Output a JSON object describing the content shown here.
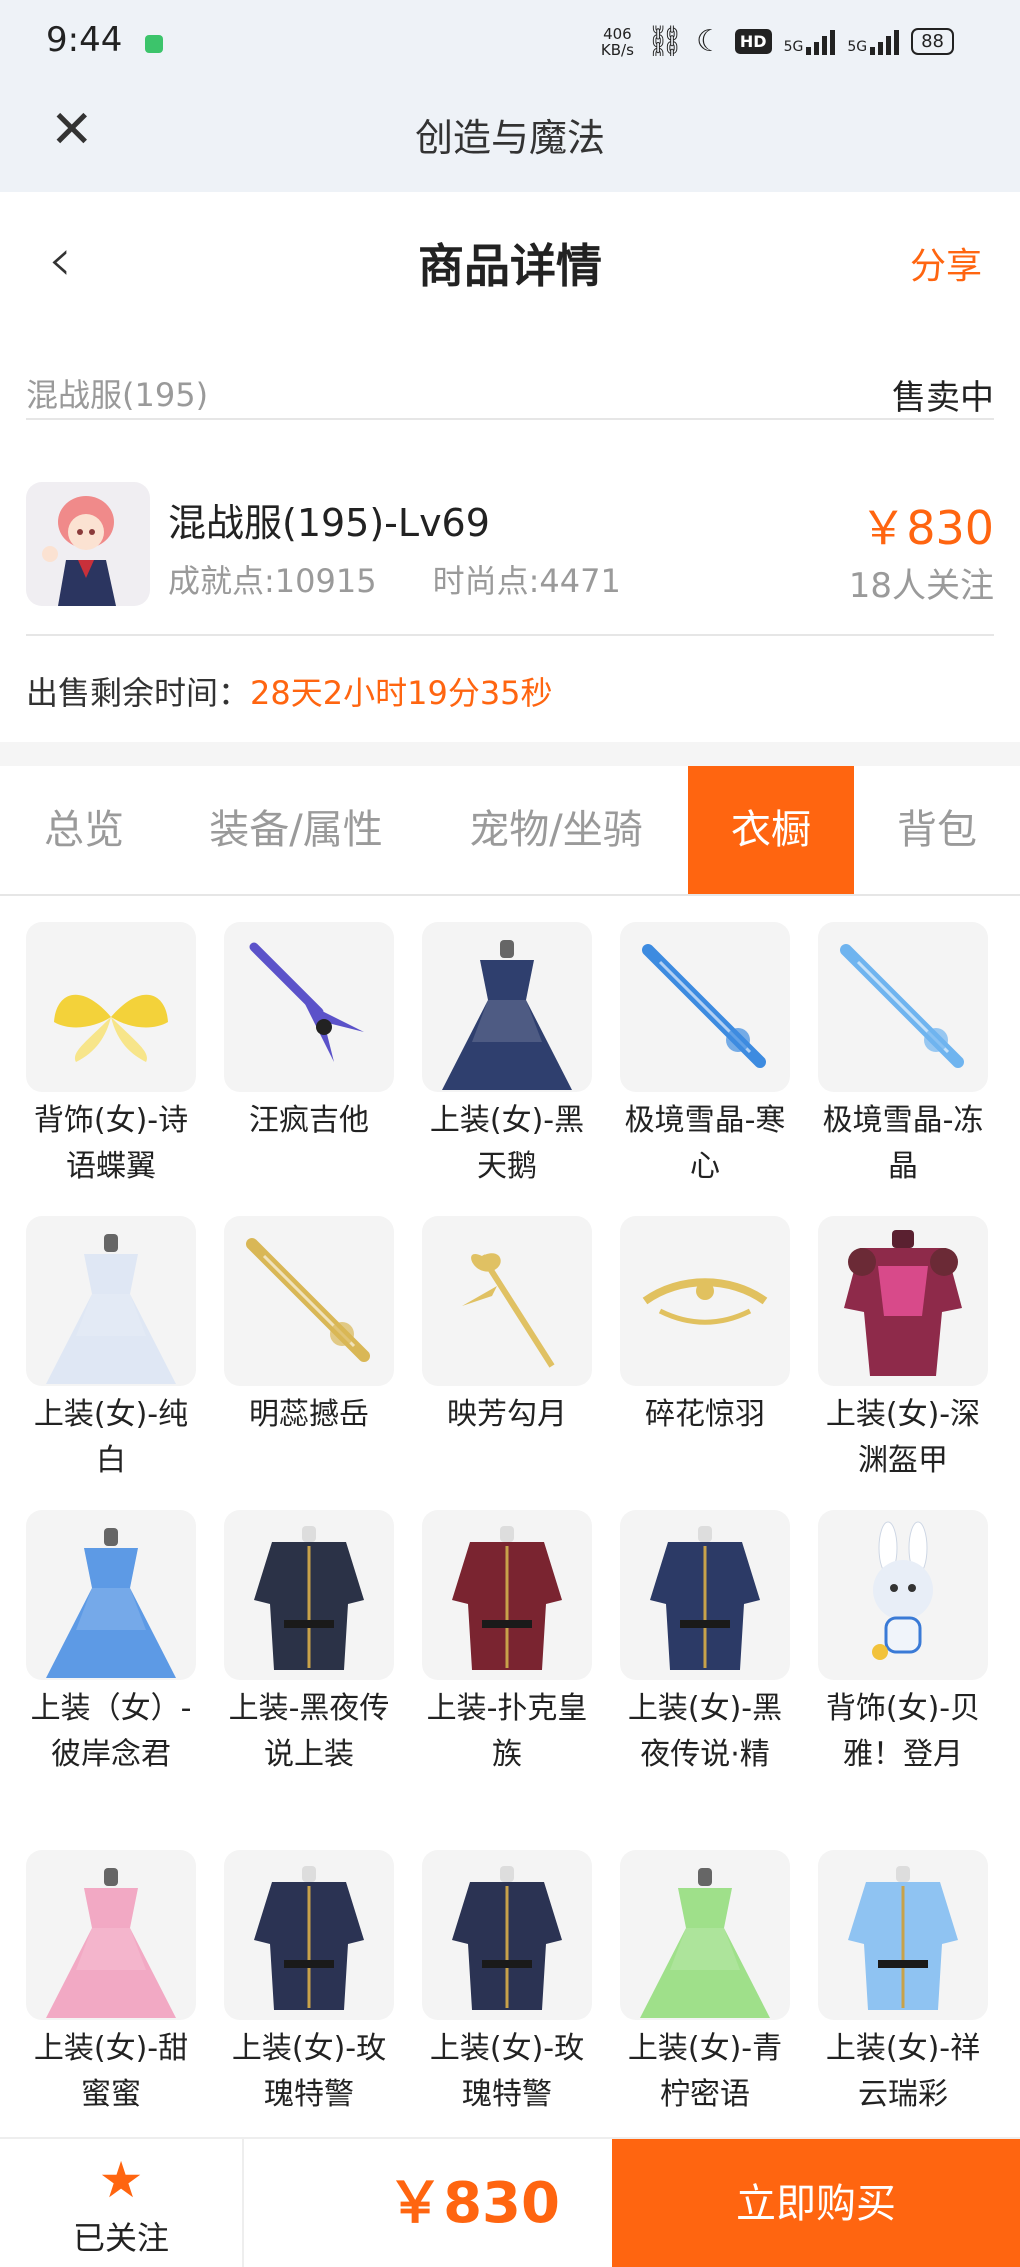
{
  "status_bar": {
    "time": "9:44",
    "speed_value": "406",
    "speed_unit": "KB/s",
    "hd_label": "HD",
    "net1": "5G",
    "net2": "5G",
    "battery": "88"
  },
  "app_bar": {
    "title": "创造与魔法"
  },
  "header": {
    "title": "商品详情",
    "share_label": "分享"
  },
  "server": {
    "name": "混战服(195)",
    "status": "售卖中"
  },
  "product": {
    "name": "混战服(195)-Lv69",
    "achievement": "成就点:10915",
    "fashion": "时尚点:4471",
    "price": "￥830",
    "followers": "18人关注"
  },
  "remaining": {
    "label": "出售剩余时间：",
    "value": "28天2小时19分35秒"
  },
  "tabs": [
    {
      "label": "总览"
    },
    {
      "label": "装备/属性"
    },
    {
      "label": "宠物/坐骑"
    },
    {
      "label": "衣橱",
      "active": true
    },
    {
      "label": "背包"
    }
  ],
  "items": [
    {
      "name": "背饰(女)-诗语蝶翼",
      "icon": "wings-icon",
      "color": "#f3d23a"
    },
    {
      "name": "汪疯吉他",
      "icon": "guitar-icon",
      "color": "#5b52c9"
    },
    {
      "name": "上装(女)-黑天鹅",
      "icon": "dress-icon",
      "color": "#2f3f6e"
    },
    {
      "name": "极境雪晶-寒心",
      "icon": "sword-icon",
      "color": "#3d8be0"
    },
    {
      "name": "极境雪晶-冻晶",
      "icon": "sword-icon",
      "color": "#6fb4ef"
    },
    {
      "name": "上装(女)-纯白",
      "icon": "dress-icon",
      "color": "#dfe7f4"
    },
    {
      "name": "明蕊撼岳",
      "icon": "sword-icon",
      "color": "#d9b756"
    },
    {
      "name": "映芳勾月",
      "icon": "staff-icon",
      "color": "#e0c163"
    },
    {
      "name": "碎花惊羽",
      "icon": "bow-icon",
      "color": "#e1c15f"
    },
    {
      "name": "上装(女)-深渊盔甲",
      "icon": "armor-icon",
      "color": "#8e2a4a"
    },
    {
      "name": "上装（女）-彼岸念君",
      "icon": "dress-icon",
      "color": "#5d9ae5"
    },
    {
      "name": "上装-黑夜传说上装",
      "icon": "coat-icon",
      "color": "#2b3247"
    },
    {
      "name": "上装-扑克皇族",
      "icon": "coat-icon",
      "color": "#7a2430"
    },
    {
      "name": "上装(女)-黑夜传说·精",
      "icon": "coat-icon",
      "color": "#2c3a66"
    },
    {
      "name": "背饰(女)-贝雅！登月",
      "icon": "rabbit-icon",
      "color": "#e8eef7"
    },
    {
      "name": "上装(女)-甜蜜蜜",
      "icon": "dress-icon",
      "color": "#f2a9c4"
    },
    {
      "name": "上装(女)-玫瑰特警",
      "icon": "coat-icon",
      "color": "#2b3353"
    },
    {
      "name": "上装(女)-玫瑰特警",
      "icon": "coat-icon",
      "color": "#2b3353"
    },
    {
      "name": "上装(女)-青柠密语",
      "icon": "dress-icon",
      "color": "#9fe08a"
    },
    {
      "name": "上装(女)-祥云瑞彩",
      "icon": "coat-icon",
      "color": "#8fc3f2"
    }
  ],
  "bottom_bar": {
    "follow_label": "已关注",
    "price": "￥830",
    "buy_label": "立即购买"
  }
}
